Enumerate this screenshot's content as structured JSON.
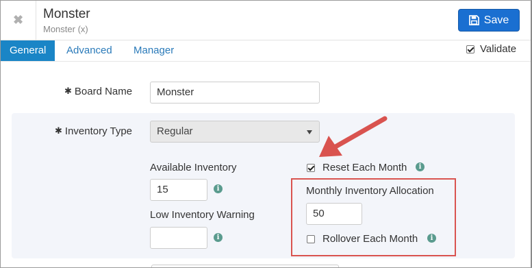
{
  "header": {
    "title": "Monster",
    "subtitle": "Monster (x)",
    "close_icon": "close-icon",
    "save_label": "Save",
    "save_icon": "floppy-disk-icon"
  },
  "tabs": [
    {
      "label": "General",
      "active": true
    },
    {
      "label": "Advanced",
      "active": false
    },
    {
      "label": "Manager",
      "active": false
    }
  ],
  "validate": {
    "label": "Validate",
    "checked": true
  },
  "form": {
    "board_name": {
      "label": "Board Name",
      "value": "Monster",
      "required": true
    },
    "inventory_type": {
      "label": "Inventory Type",
      "value": "Regular",
      "required": true
    },
    "available_inventory": {
      "label": "Available Inventory",
      "value": "15"
    },
    "low_inventory_warning": {
      "label": "Low Inventory Warning",
      "value": ""
    },
    "reset_each_month": {
      "label": "Reset Each Month",
      "checked": true
    },
    "monthly_inventory_allocation": {
      "label": "Monthly Inventory Allocation",
      "value": "50"
    },
    "rollover_each_month": {
      "label": "Rollover Each Month",
      "checked": false
    }
  },
  "colors": {
    "accent": "#1a85c6",
    "save_button": "#1a6fd1",
    "info_icon": "#5a9b8e",
    "annotation_red": "#d9534f",
    "panel_bg": "#f3f5fa"
  }
}
